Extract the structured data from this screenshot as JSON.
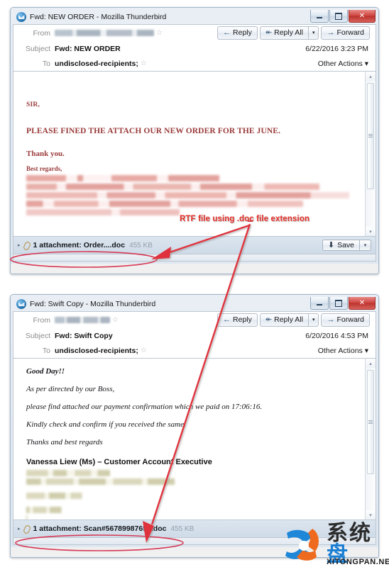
{
  "windows": [
    {
      "id": "window-new-order",
      "title": "Fwd: NEW ORDER - Mozilla Thunderbird",
      "icon": "thunderbird-icon",
      "controls": {
        "minimize": "–",
        "maximize": "□",
        "close": "✕"
      },
      "header": {
        "from_label": "From",
        "from_value": "",
        "subject_label": "Subject",
        "subject_value": "Fwd: NEW ORDER",
        "date": "6/22/2016 3:23 PM",
        "to_label": "To",
        "to_value": "undisclosed-recipients;",
        "other_actions": "Other Actions",
        "other_actions_caret": "▾",
        "star": "☆"
      },
      "actions": {
        "reply": "Reply",
        "reply_all": "Reply All",
        "forward": "Forward",
        "reply_icon": "←",
        "reply_all_icon": "↞",
        "forward_icon": "→",
        "dropdown_caret": "▾"
      },
      "body": {
        "salutation": "SIR,",
        "line1": "PLEASE FINED THE ATTACH OUR NEW ORDER FOR  THE JUNE.",
        "line2": "Thank you.",
        "line3": "Best regards,",
        "signature_redacted": true
      },
      "attachment": {
        "twisty": "▸",
        "icon": "paperclip-icon",
        "label": "1 attachment: Order....doc",
        "size": "455 KB",
        "save_label": "Save",
        "save_icon": "⬇",
        "save_caret": "▾"
      },
      "scrollbar": {
        "up": "▴",
        "down": "▾"
      }
    },
    {
      "id": "window-swift-copy",
      "title": "Fwd: Swift Copy - Mozilla Thunderbird",
      "icon": "thunderbird-icon",
      "controls": {
        "minimize": "–",
        "maximize": "□",
        "close": "✕"
      },
      "header": {
        "from_label": "From",
        "from_value": "",
        "subject_label": "Subject",
        "subject_value": "Fwd: Swift Copy",
        "date": "6/20/2016 4:53 PM",
        "to_label": "To",
        "to_value": "undisclosed-recipients;",
        "other_actions": "Other Actions",
        "other_actions_caret": "▾",
        "star": "☆"
      },
      "actions": {
        "reply": "Reply",
        "reply_all": "Reply All",
        "forward": "Forward",
        "reply_icon": "←",
        "reply_all_icon": "↞",
        "forward_icon": "→",
        "dropdown_caret": "▾"
      },
      "body": {
        "greeting": "Good Day!!",
        "line1": "As per directed by our Boss,",
        "line2": "please find attached our payment confirmation which we paid on 17:06:16.",
        "line3": "Kindly check and confirm if you received the same.",
        "line4": "Thanks and best regards",
        "signer": "Vanessa Liew (Ms) – Customer Account Executive",
        "signature_redacted": true
      },
      "attachment": {
        "twisty": "▸",
        "icon": "paperclip-icon",
        "label": "1 attachment: Scan#56789987654.doc",
        "size": "455 KB"
      },
      "scrollbar": {
        "up": "▴",
        "down": "▾"
      }
    }
  ],
  "annotations": {
    "callout_text": "RTF file using .doc file extension",
    "callout_color": "#e8312a",
    "arrow_to_attachment_1": "arrow pointing left-down to first attachment",
    "arrow_to_attachment_2": "arrow pointing down to second attachment"
  },
  "watermark": {
    "cn_text_dark": "系统",
    "cn_text_blue": "盘",
    "url": "XITONGPAN.NET",
    "logo": "x-swirl-logo"
  }
}
